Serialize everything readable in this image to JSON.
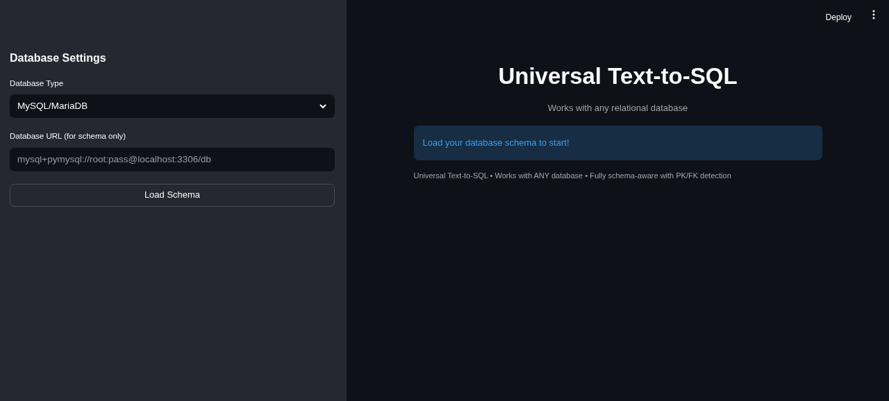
{
  "sidebar": {
    "title": "Database Settings",
    "database_type": {
      "label": "Database Type",
      "value": "MySQL/MariaDB"
    },
    "database_url": {
      "label": "Database URL (for schema only)",
      "placeholder": "mysql+pymysql://root:pass@localhost:3306/db"
    },
    "button": "Load Schema"
  },
  "header": {
    "deploy": "Deploy"
  },
  "main": {
    "title": "Universal Text-to-SQL",
    "subtitle": "Works with any relational database",
    "info": "Load your database schema to start!",
    "footer": "Universal Text-to-SQL • Works with ANY database • Fully schema-aware with PK/FK detection"
  }
}
